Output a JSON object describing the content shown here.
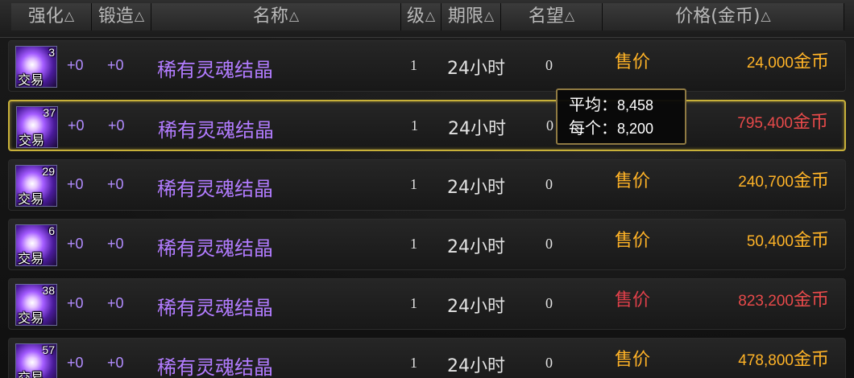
{
  "headers": [
    {
      "label": "强化"
    },
    {
      "label": "锻造"
    },
    {
      "label": "名称"
    },
    {
      "label": "级"
    },
    {
      "label": "期限"
    },
    {
      "label": "名望"
    },
    {
      "label": "价格(金币)"
    }
  ],
  "sort_glyph": "△",
  "rows": [
    {
      "qty": "3",
      "trade": "交易",
      "enh": "+0",
      "forge": "+0",
      "name": "稀有灵魂结晶",
      "level": "1",
      "time": "24小时",
      "fame": "0",
      "sell": "售价",
      "price_num": "24,000",
      "price_unit": "金币"
    },
    {
      "qty": "37",
      "trade": "交易",
      "enh": "+0",
      "forge": "+0",
      "name": "稀有灵魂结晶",
      "level": "1",
      "time": "24小时",
      "fame": "0",
      "sell": "",
      "price_num": "795,400",
      "price_unit": "金币"
    },
    {
      "qty": "29",
      "trade": "交易",
      "enh": "+0",
      "forge": "+0",
      "name": "稀有灵魂结晶",
      "level": "1",
      "time": "24小时",
      "fame": "0",
      "sell": "售价",
      "price_num": "240,700",
      "price_unit": "金币"
    },
    {
      "qty": "6",
      "trade": "交易",
      "enh": "+0",
      "forge": "+0",
      "name": "稀有灵魂结晶",
      "level": "1",
      "time": "24小时",
      "fame": "0",
      "sell": "售价",
      "price_num": "50,400",
      "price_unit": "金币"
    },
    {
      "qty": "38",
      "trade": "交易",
      "enh": "+0",
      "forge": "+0",
      "name": "稀有灵魂结晶",
      "level": "1",
      "time": "24小时",
      "fame": "0",
      "sell": "售价",
      "price_num": "823,200",
      "price_unit": "金币"
    },
    {
      "qty": "57",
      "trade": "交易",
      "enh": "+0",
      "forge": "+0",
      "name": "稀有灵魂结晶",
      "level": "1",
      "time": "24小时",
      "fame": "0",
      "sell": "售价",
      "price_num": "478,800",
      "price_unit": "金币"
    }
  ],
  "tooltip": {
    "avg_label": "平均：",
    "avg_value": "8,458",
    "each_label": "每个：",
    "each_value": "8,200"
  },
  "colors": {
    "price_normal": "#ffb327",
    "price_high": "#e84a4a",
    "item_name": "#b27cff",
    "selected_border": "#c8b13a"
  }
}
